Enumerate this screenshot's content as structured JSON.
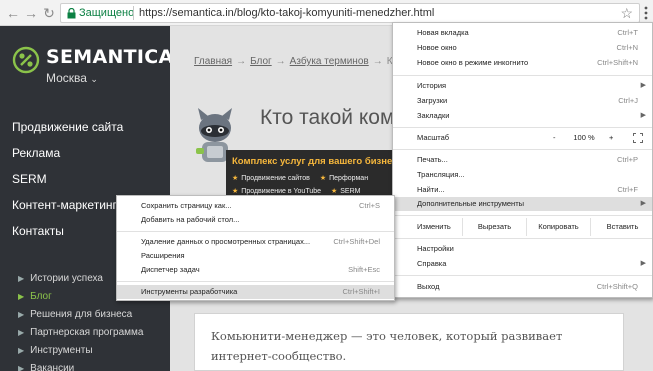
{
  "browser": {
    "secure_label": "Защищено",
    "url": "https://semantica.in/blog/kto-takoj-komyuniti-menedzher.html"
  },
  "sidebar": {
    "brand": "SEMANTICA",
    "city": "Москва",
    "menu": [
      "Продвижение сайта",
      "Реклама",
      "SERM",
      "Контент-маркетинг",
      "Контакты"
    ],
    "submenu": [
      "Истории успеха",
      "Блог",
      "Решения для бизнеса",
      "Партнерская программа",
      "Инструменты",
      "Вакансии"
    ],
    "active_sub": 1
  },
  "content": {
    "breadcrumb": [
      "Главная",
      "Блог",
      "Азбука терминов",
      "К"
    ],
    "title": "Кто такой ком",
    "banner_title": "Комплекс услуг для вашего бизне",
    "banner_items": [
      "Продвижение сайтов",
      "Перформан",
      "Продвижение в YouTube",
      "SERM"
    ],
    "article_text": "Комьюнити-менеджер — это человек, который развивает интернет-сообщество."
  },
  "main_menu": {
    "new_tab": "Новая вкладка",
    "new_tab_sc": "Ctrl+T",
    "new_window": "Новое окно",
    "new_window_sc": "Ctrl+N",
    "incognito": "Новое окно в режиме инкогнито",
    "incognito_sc": "Ctrl+Shift+N",
    "history": "История",
    "downloads": "Загрузки",
    "downloads_sc": "Ctrl+J",
    "bookmarks": "Закладки",
    "zoom": "Масштаб",
    "zoom_minus": "-",
    "zoom_value": "100 %",
    "zoom_plus": "+",
    "print": "Печать...",
    "print_sc": "Ctrl+P",
    "cast": "Трансляция...",
    "find": "Найти...",
    "find_sc": "Ctrl+F",
    "more_tools": "Дополнительные инструменты",
    "edit": "Изменить",
    "cut": "Вырезать",
    "copy": "Копировать",
    "paste": "Вставить",
    "settings": "Настройки",
    "help": "Справка",
    "exit": "Выход",
    "exit_sc": "Ctrl+Shift+Q"
  },
  "sub_menu": {
    "save_page": "Сохранить страницу как...",
    "save_page_sc": "Ctrl+S",
    "add_desktop": "Добавить на рабочий стол...",
    "clear_data": "Удаление данных о просмотренных страницах...",
    "clear_data_sc": "Ctrl+Shift+Del",
    "extensions": "Расширения",
    "task_manager": "Диспетчер задач",
    "task_manager_sc": "Shift+Esc",
    "dev_tools": "Инструменты разработчика",
    "dev_tools_sc": "Ctrl+Shift+I"
  },
  "colors": {
    "sidebar_bg": "#2f3237",
    "accent_green": "#8bc34a",
    "banner_accent": "#f6b73c",
    "secure_green": "#0b8043"
  }
}
